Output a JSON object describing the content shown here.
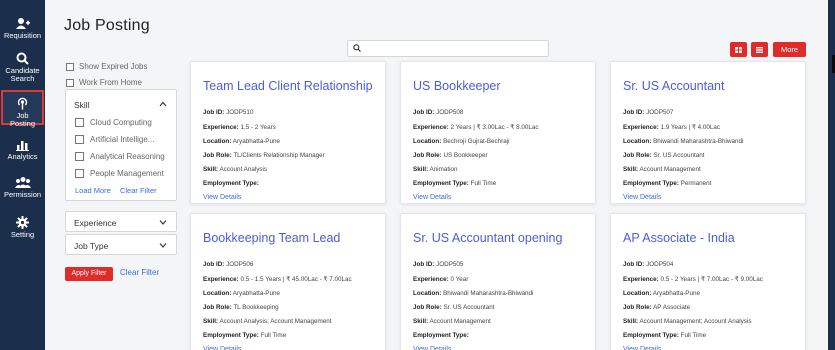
{
  "sidebar": {
    "items": [
      {
        "label": "Requisition",
        "icon": "users-plus-icon"
      },
      {
        "label": "Candidate Search",
        "icon": "search-icon"
      },
      {
        "label": "Job Posting",
        "icon": "broadcast-icon"
      },
      {
        "label": "Analytics",
        "icon": "bar-chart-icon"
      },
      {
        "label": "Permission",
        "icon": "group-icon"
      },
      {
        "label": "Setting",
        "icon": "gear-icon"
      }
    ],
    "active": "Job Posting"
  },
  "page": {
    "title": "Job Posting"
  },
  "search": {
    "placeholder": "",
    "value": ""
  },
  "toolbar": {
    "more_label": "More",
    "grid_icon": "grid-view-icon",
    "list_icon": "list-view-icon",
    "accent": "#e02b2b"
  },
  "filters": {
    "show_expired": "Show Expired Jobs",
    "work_from_home": "Work From Home",
    "skill": {
      "title": "Skill",
      "options": [
        "Cloud Computing",
        "Artificial Intellige...",
        "Analytical Reasoning",
        "People Management"
      ],
      "load_more": "Load More",
      "clear": "Clear Filter"
    },
    "experience": "Experience",
    "job_type": "Job Type",
    "apply": "Apply Filter",
    "clear": "Clear Filter"
  },
  "labels": {
    "job_id": "Job ID:",
    "experience": "Experience:",
    "location": "Location:",
    "job_role": "Job Role:",
    "skill": "Skill:",
    "employment_type": "Employment Type:",
    "view_details": "View Details"
  },
  "cards": [
    {
      "title": "Team Lead Client Relationship",
      "job_id": "JODP510",
      "experience": "1.5 - 2 Years",
      "location": "Aryabhatta-Pune",
      "job_role": "TL/Clients Relationship Manager",
      "skill": "Account Analysis",
      "employment_type": ""
    },
    {
      "title": "US Bookkeeper",
      "job_id": "JODP508",
      "experience": "2 Years | ₹ 3.00Lac - ₹ 8.00Lac",
      "location": "Bechroji Gujrat-Bechraji",
      "job_role": "US Bookkeeper",
      "skill": "Animation",
      "employment_type": "Full Time"
    },
    {
      "title": "Sr. US Accountant",
      "job_id": "JODP507",
      "experience": "1.9 Years | ₹ 4.00Lac",
      "location": "Bhiwandi Maharashtra-Bhiwandi",
      "job_role": "Sr. US Accountant",
      "skill": "Account Management",
      "employment_type": "Permanent"
    },
    {
      "title": "Bookkeeping Team Lead",
      "job_id": "JODP506",
      "experience": "0.5 - 1.5 Years | ₹ 45.00Lac - ₹ 7.00Lac",
      "location": "Aryabhatta-Pune",
      "job_role": "TL Bookkeeping",
      "skill": "Account Analysis; Account Management",
      "employment_type": "Full Time"
    },
    {
      "title": "Sr. US Accountant opening",
      "job_id": "JODP505",
      "experience": "0 Year",
      "location": "Bhiwandi Maharashtra-Bhiwandi",
      "job_role": "Sr. US Accountant",
      "skill": "Account Management",
      "employment_type": ""
    },
    {
      "title": "AP Associate - India",
      "job_id": "JODP504",
      "experience": "0.5 - 2 Years | ₹ 7.00Lac - ₹ 9.00Lac",
      "location": "Aryabhatta-Pune",
      "job_role": "AP Associate",
      "skill": "Account Management; Account Analysis",
      "employment_type": "Full Time"
    }
  ]
}
